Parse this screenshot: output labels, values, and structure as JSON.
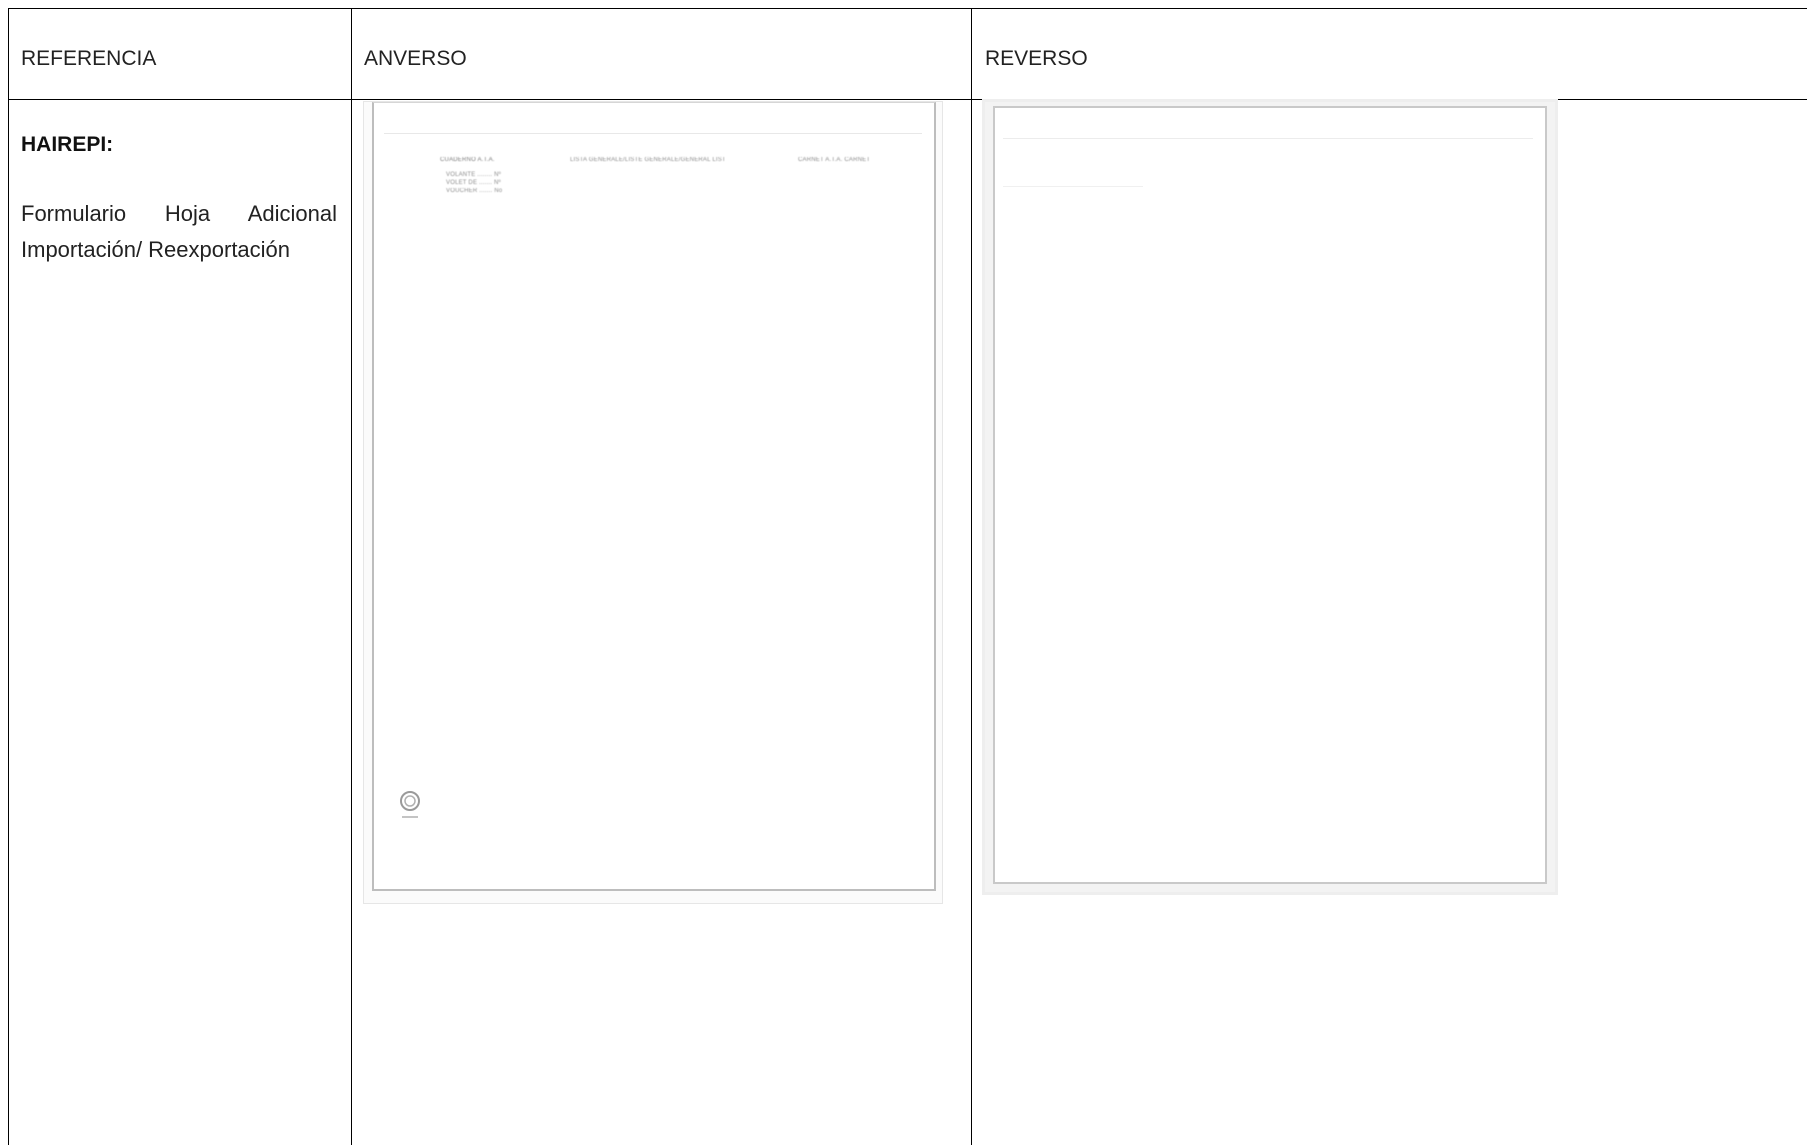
{
  "table": {
    "headers": {
      "referencia": "REFERENCIA",
      "anverso": "ANVERSO",
      "reverso": "REVERSO"
    },
    "row": {
      "code": "HAIREPI:",
      "description": "Formulario Hoja Adicional Importación/ Reexportación"
    }
  },
  "front_form": {
    "header_left": "CUADERNO A.T.A.",
    "header_center": "LISTA GENERALE/LISTE GENERALE/GENERAL LIST",
    "header_right": "CARNET A.T.A. CARNET",
    "fields": [
      "VOLANTE ........ Nº",
      "VOLET DE ....... Nº",
      "VOUCHER ....... No"
    ]
  },
  "colors": {
    "border": "#000000",
    "thumb_border": "#bdbdbd"
  }
}
